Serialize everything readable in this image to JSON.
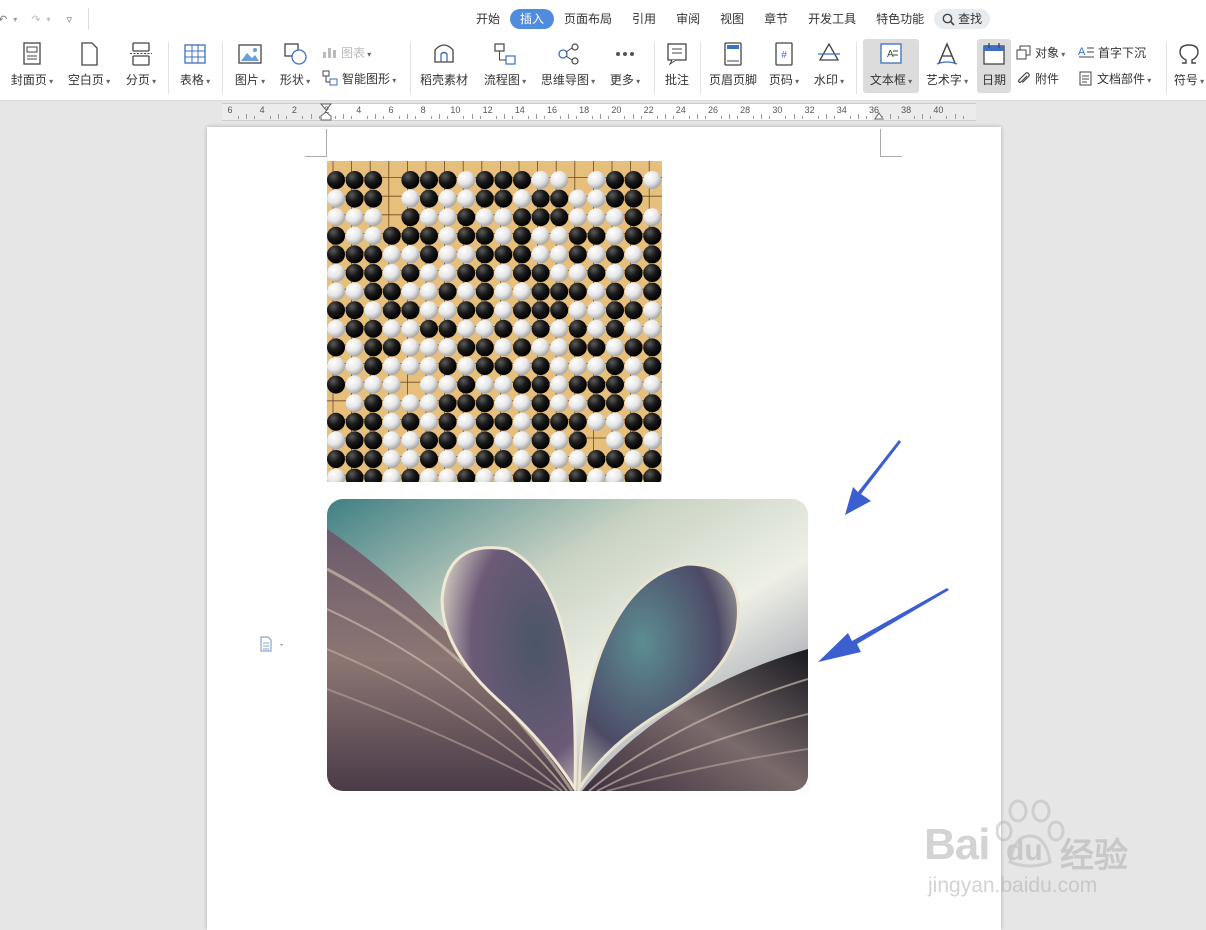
{
  "quick_access": {
    "undo": "↶",
    "redo": "↷",
    "more": "▿"
  },
  "tabs": [
    {
      "label": "开始"
    },
    {
      "label": "插入"
    },
    {
      "label": "页面布局"
    },
    {
      "label": "引用"
    },
    {
      "label": "审阅"
    },
    {
      "label": "视图"
    },
    {
      "label": "章节"
    },
    {
      "label": "开发工具"
    },
    {
      "label": "特色功能"
    }
  ],
  "search": {
    "label": "查找"
  },
  "ribbon": {
    "cover_page": "封面页",
    "blank_page": "空白页",
    "page_break": "分页",
    "table": "表格",
    "picture": "图片",
    "shapes": "形状",
    "chart": "图表",
    "smart_art": "智能图形",
    "docer_material": "稻壳素材",
    "flowchart": "流程图",
    "mind_map": "思维导图",
    "more": "更多",
    "comment": "批注",
    "header_footer": "页眉页脚",
    "page_number": "页码",
    "watermark": "水印",
    "text_box": "文本框",
    "word_art": "艺术字",
    "date": "日期",
    "object": "对象",
    "attachment": "附件",
    "drop_cap": "首字下沉",
    "doc_parts": "文档部件",
    "symbol": "符号"
  },
  "ruler": {
    "labels": [
      "6",
      "4",
      "2",
      "2",
      "4",
      "6",
      "8",
      "10",
      "12",
      "14",
      "16",
      "18",
      "20",
      "22",
      "24",
      "26",
      "28",
      "30",
      "32",
      "34",
      "36",
      "38",
      "40"
    ]
  },
  "watermark": {
    "brand": "Bai",
    "brand2": "du",
    "cn": "经验",
    "url": "jingyan.baidu.com"
  },
  "colors": {
    "accent": "#4f8cde",
    "arrow": "#3b5fd0"
  }
}
